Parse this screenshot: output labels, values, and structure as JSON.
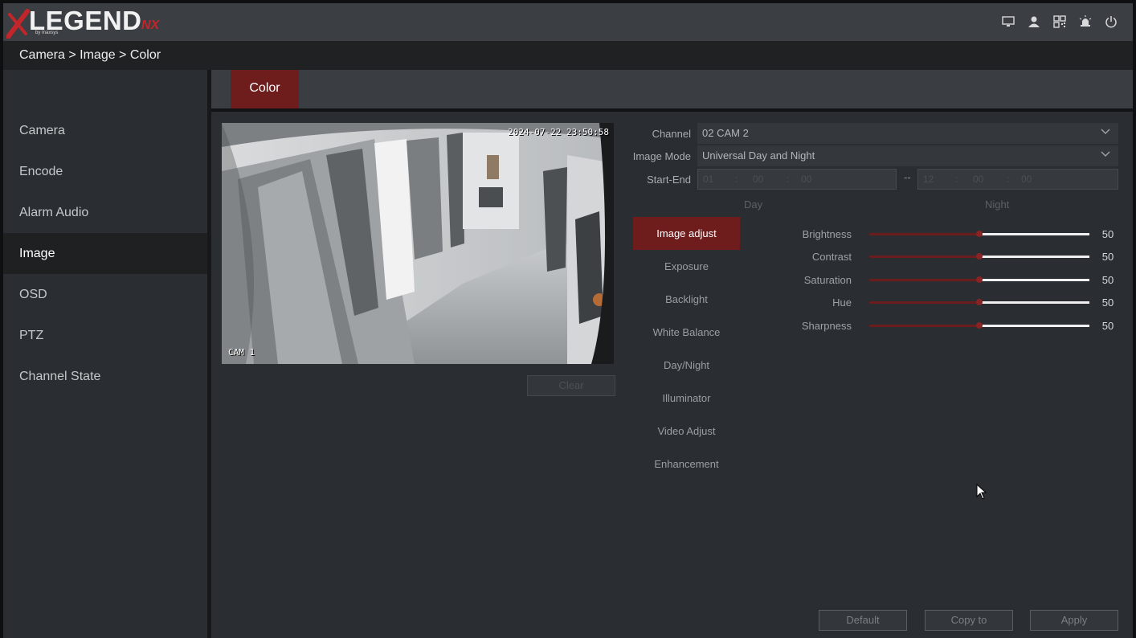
{
  "header": {
    "logo_main": "LEGEND",
    "logo_suffix": "NX",
    "logo_sub": "by Inaxsys",
    "icons": [
      "monitor-icon",
      "user-icon",
      "qr-icon",
      "alarm-icon",
      "power-icon"
    ]
  },
  "breadcrumb": "Camera > Image > Color",
  "sidebar": {
    "items": [
      {
        "label": "Camera"
      },
      {
        "label": "Encode"
      },
      {
        "label": "Alarm Audio"
      },
      {
        "label": "Image"
      },
      {
        "label": "OSD"
      },
      {
        "label": "PTZ"
      },
      {
        "label": "Channel State"
      }
    ],
    "active": "Image"
  },
  "tabs": [
    {
      "label": "Color"
    }
  ],
  "preview": {
    "timestamp": "2024-07-22 23:50:58",
    "camera_name": "CAM 1",
    "clear_label": "Clear"
  },
  "form": {
    "channel_label": "Channel",
    "channel_value": "02 CAM 2",
    "image_mode_label": "Image Mode",
    "image_mode_value": "Universal Day and Night",
    "start_end_label": "Start-End",
    "start": {
      "h": "01",
      "m": "00",
      "s": "00"
    },
    "end": {
      "h": "12",
      "m": "00",
      "s": "00"
    },
    "separator": "--",
    "colon": ":",
    "day_label": "Day",
    "night_label": "Night"
  },
  "submenu": [
    {
      "label": "Image adjust"
    },
    {
      "label": "Exposure"
    },
    {
      "label": "Backlight"
    },
    {
      "label": "White Balance"
    },
    {
      "label": "Day/Night"
    },
    {
      "label": "Illuminator"
    },
    {
      "label": "Video Adjust"
    },
    {
      "label": "Enhancement"
    }
  ],
  "adjust": [
    {
      "label": "Brightness",
      "value": "50"
    },
    {
      "label": "Contrast",
      "value": "50"
    },
    {
      "label": "Saturation",
      "value": "50"
    },
    {
      "label": "Hue",
      "value": "50"
    },
    {
      "label": "Sharpness",
      "value": "50"
    }
  ],
  "slider_max": 100,
  "buttons": {
    "default": "Default",
    "copy_to": "Copy to",
    "apply": "Apply"
  },
  "colors": {
    "accent_red": "#6e1c1c",
    "brand_red": "#c2262b",
    "background": "#2a2e32"
  }
}
